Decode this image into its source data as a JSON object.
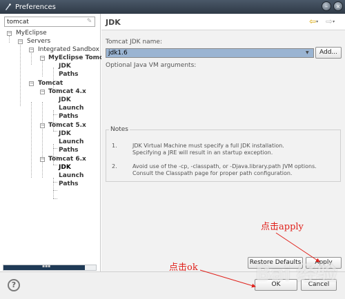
{
  "window": {
    "title": "Preferences"
  },
  "sidebar": {
    "filter_value": "tomcat",
    "tree": [
      {
        "label": "MyEclipse",
        "bold": false
      },
      {
        "label": "Servers",
        "bold": false
      },
      {
        "label": "Integrated Sandbox",
        "bold": false
      },
      {
        "label": "MyEclipse Tomc",
        "bold": true
      },
      {
        "label": "JDK",
        "bold": true
      },
      {
        "label": "Paths",
        "bold": true
      },
      {
        "label": "Tomcat",
        "bold": true
      },
      {
        "label": "Tomcat 4.x",
        "bold": true
      },
      {
        "label": "JDK",
        "bold": true
      },
      {
        "label": "Launch",
        "bold": true
      },
      {
        "label": "Paths",
        "bold": true
      },
      {
        "label": "Tomcat 5.x",
        "bold": true
      },
      {
        "label": "JDK",
        "bold": true
      },
      {
        "label": "Launch",
        "bold": true
      },
      {
        "label": "Paths",
        "bold": true
      },
      {
        "label": "Tomcat 6.x",
        "bold": true
      },
      {
        "label": "JDK",
        "bold": true
      },
      {
        "label": "Launch",
        "bold": true
      },
      {
        "label": "Paths",
        "bold": true
      }
    ]
  },
  "page": {
    "title": "JDK",
    "jdk_name_label": "Tomcat JDK name:",
    "jdk_name_value": "jdk1.6",
    "add_button": "Add...",
    "vm_args_label": "Optional Java VM arguments:",
    "notes_title": "Notes",
    "notes": [
      {
        "num": "1.",
        "text": "JDK Virtual Machine must specify a full JDK installation.\nSpecifying a JRE will result in an startup exception."
      },
      {
        "num": "2.",
        "text": "Avoid use of the -cp, -classpath, or -Djava.library.path JVM options.\nConsult the Classpath page for proper path configuration."
      }
    ],
    "restore_button": "Restore Defaults",
    "apply_button": "Apply"
  },
  "footer": {
    "help": "?",
    "ok_button": "OK",
    "cancel_button": "Cancel"
  },
  "annotations": {
    "apply_note": "点击apply",
    "ok_note": "点击ok",
    "watermark": "Bai 经验"
  }
}
